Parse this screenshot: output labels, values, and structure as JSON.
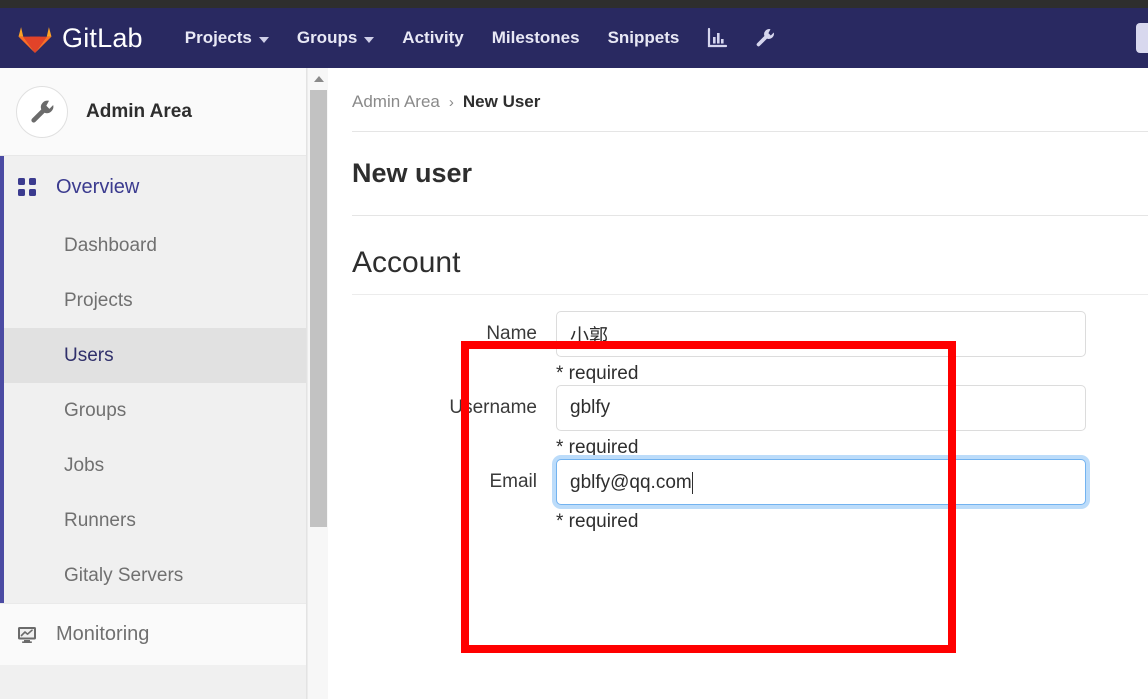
{
  "navbar": {
    "brand": "GitLab",
    "logo_icon": "gitlab-tanuki-icon",
    "items": [
      {
        "label": "Projects",
        "has_caret": true,
        "icon": "chevron-down-icon"
      },
      {
        "label": "Groups",
        "has_caret": true,
        "icon": "chevron-down-icon"
      },
      {
        "label": "Activity",
        "has_caret": false
      },
      {
        "label": "Milestones",
        "has_caret": false
      },
      {
        "label": "Snippets",
        "has_caret": false
      }
    ],
    "icon_buttons": [
      {
        "name": "analytics-chart-icon",
        "label": "Analytics"
      },
      {
        "name": "admin-wrench-icon",
        "label": "Admin Area"
      }
    ],
    "background_color": "#292961",
    "top_strip_color": "#2e2e2e"
  },
  "sidebar": {
    "header_title": "Admin Area",
    "header_icon": "wrench-icon",
    "section": {
      "label": "Overview",
      "icon": "grid-dashboard-icon",
      "active_indicator_color": "#4b4ba3"
    },
    "items": [
      {
        "label": "Dashboard",
        "active": false
      },
      {
        "label": "Projects",
        "active": false
      },
      {
        "label": "Users",
        "active": true
      },
      {
        "label": "Groups",
        "active": false
      },
      {
        "label": "Jobs",
        "active": false
      },
      {
        "label": "Runners",
        "active": false
      },
      {
        "label": "Gitaly Servers",
        "active": false
      }
    ],
    "bottom": {
      "label": "Monitoring",
      "icon": "monitor-chart-icon"
    },
    "scrollbar": {
      "up_arrow_icon": "chevron-up-icon"
    }
  },
  "content": {
    "breadcrumb": {
      "parent": "Admin Area",
      "separator": "›",
      "current": "New User"
    },
    "page_title": "New user",
    "section_title": "Account",
    "form": {
      "fields": [
        {
          "label": "Name",
          "value": "小郭",
          "placeholder": "",
          "help": "* required",
          "focused": false
        },
        {
          "label": "Username",
          "value": "gblfy",
          "placeholder": "",
          "help": "* required",
          "focused": false
        },
        {
          "label": "Email",
          "value": "gblfy@qq.com",
          "placeholder": "",
          "help": "* required",
          "focused": true
        }
      ]
    }
  },
  "annotation": {
    "type": "highlight-rectangle",
    "color": "#ff0000"
  }
}
